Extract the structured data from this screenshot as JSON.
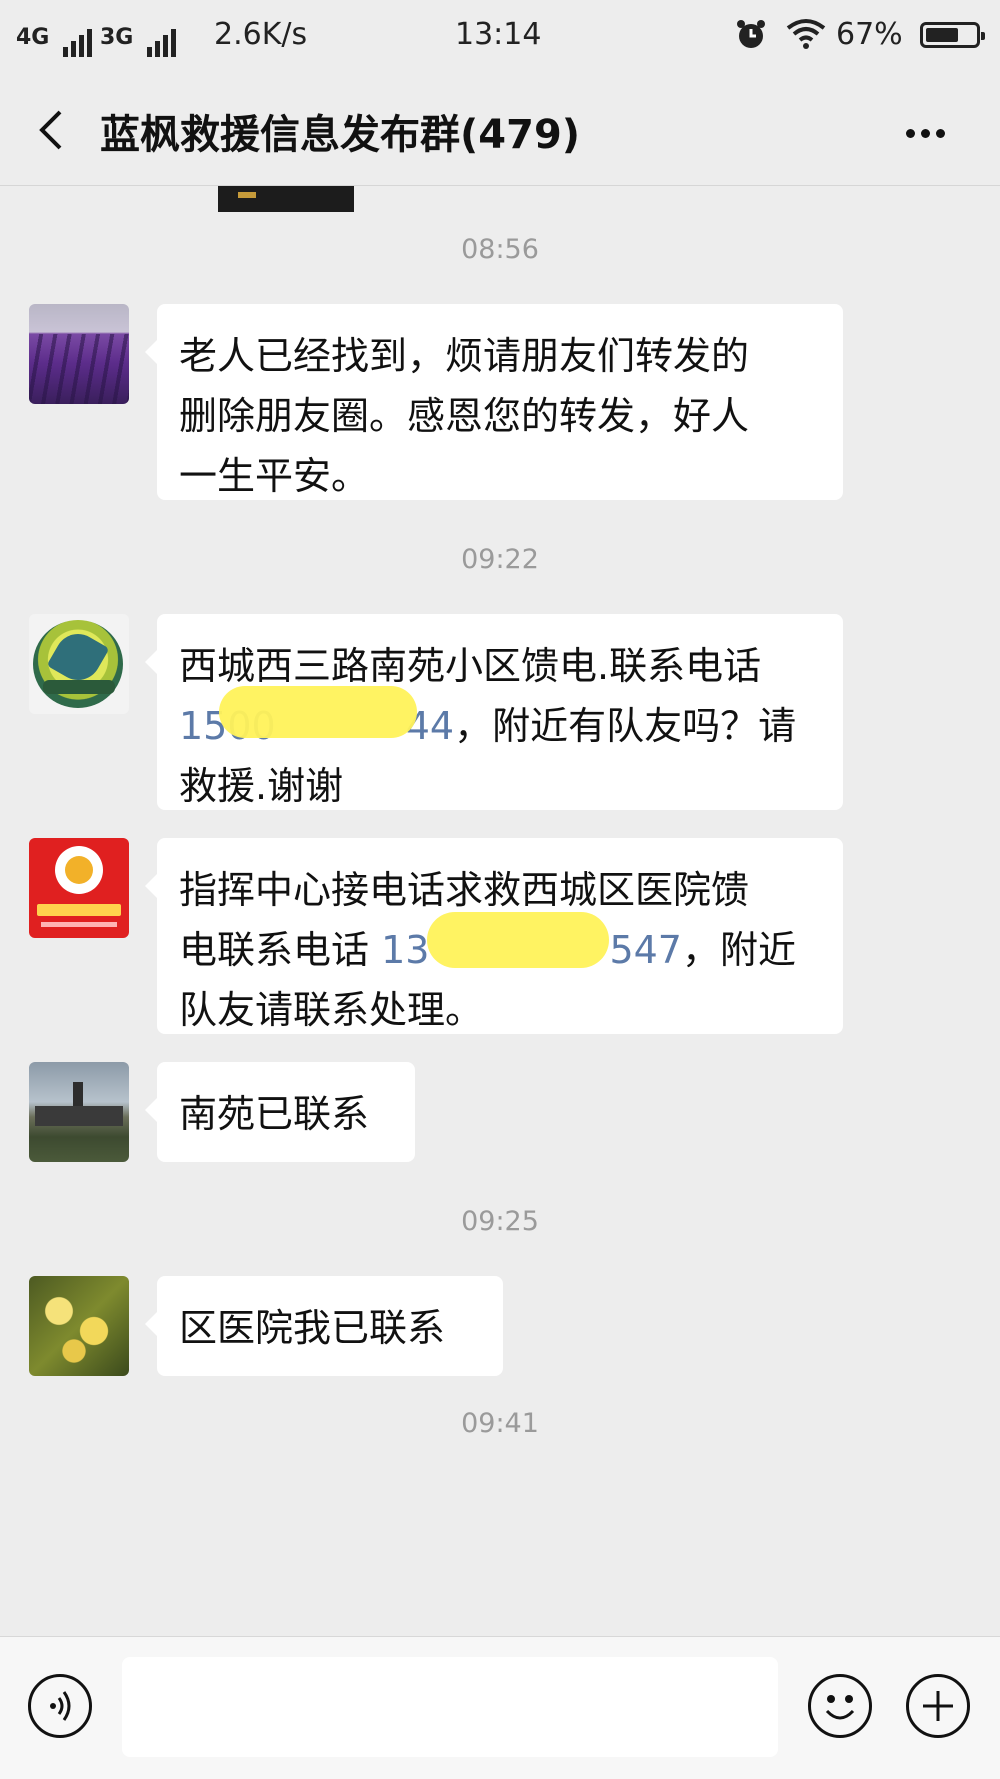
{
  "status_bar": {
    "network1": "4G",
    "network2": "3G",
    "speed": "2.6K/s",
    "time": "13:14",
    "battery": "67%",
    "battery_level": 0.67
  },
  "header": {
    "title": "蓝枫救援信息发布群(479)"
  },
  "messages": [
    {
      "timestamp": "08:56",
      "text": "老人已经找到，烦请朋友们转发的删除朋友圈。感恩您的转发，好人一生平安。",
      "lines": [
        "老人已经找到，烦请朋友们转发的",
        "删除朋友圈。感恩您的转发，好人",
        "一生平安。"
      ]
    },
    {
      "timestamp": "09:22",
      "line1": "西城西三路南苑小区馈电.联系电话",
      "phone": "150000000044",
      "phone_visible": "1500",
      "phone_end": "44",
      "line2_suffix": "，附近有队友吗？请",
      "line3": "救援.谢谢"
    },
    {
      "line1": "指挥中心接电话求救西城区医院馈",
      "line2_prefix": "电联系电话 ",
      "phone_visible": "13",
      "phone_end": "547",
      "line2_suffix": "，附近",
      "line3": "队友请联系处理。"
    },
    {
      "text": "南苑已联系"
    },
    {
      "timestamp": "09:25",
      "text": "区医院我已联系"
    },
    {
      "timestamp": "09:41"
    }
  ],
  "avatars": [
    "lavender-field",
    "dolphin-logo",
    "red-rescue-logo",
    "building-photo",
    "yellow-flower"
  ],
  "input": {
    "placeholder": ""
  },
  "icons": {
    "back": "chevron-left-icon",
    "more": "more-dots-icon",
    "voice": "voice-icon",
    "emoji": "emoji-icon",
    "plus": "plus-icon"
  }
}
